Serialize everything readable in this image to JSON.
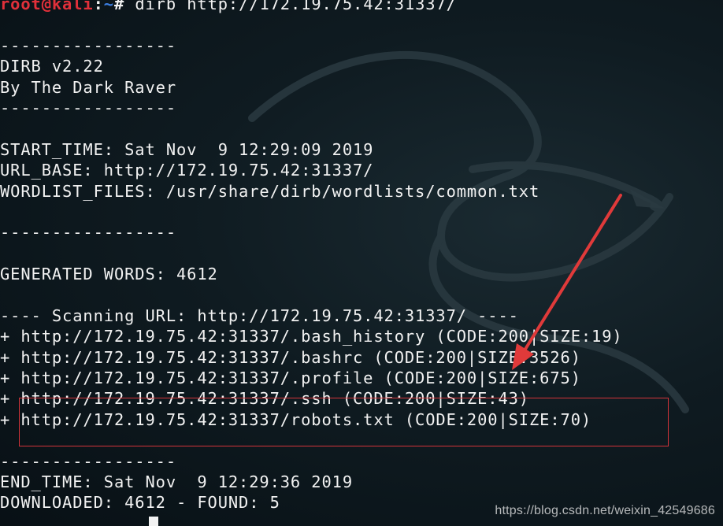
{
  "prompt": {
    "user_host": "root@kali",
    "separator": ":",
    "path": "~",
    "symbol": "#",
    "command": " dirb http://172.19.75.42:31337/"
  },
  "lines": [
    "",
    "-----------------",
    "DIRB v2.22",
    "By The Dark Raver",
    "-----------------",
    "",
    "START_TIME: Sat Nov  9 12:29:09 2019",
    "URL_BASE: http://172.19.75.42:31337/",
    "WORDLIST_FILES: /usr/share/dirb/wordlists/common.txt",
    "",
    "-----------------",
    "",
    "GENERATED WORDS: 4612",
    "",
    "---- Scanning URL: http://172.19.75.42:31337/ ----",
    "+ http://172.19.75.42:31337/.bash_history (CODE:200|SIZE:19)",
    "+ http://172.19.75.42:31337/.bashrc (CODE:200|SIZE:3526)",
    "+ http://172.19.75.42:31337/.profile (CODE:200|SIZE:675)",
    "+ http://172.19.75.42:31337/.ssh (CODE:200|SIZE:43)",
    "+ http://172.19.75.42:31337/robots.txt (CODE:200|SIZE:70)",
    "",
    "-----------------",
    "END_TIME: Sat Nov  9 12:29:36 2019",
    "DOWNLOADED: 4612 - FOUND: 5"
  ],
  "watermark": "https://blog.csdn.net/weixin_42549686",
  "colors": {
    "text": "#f2f2f2",
    "user_host": "#e0303a",
    "path": "#3b7ee0",
    "annotation": "#d4343a",
    "background": "#0f1b21"
  },
  "icons": {
    "background_logo": "kali-dragon-icon",
    "annotation_arrow": "red-arrow-icon"
  }
}
